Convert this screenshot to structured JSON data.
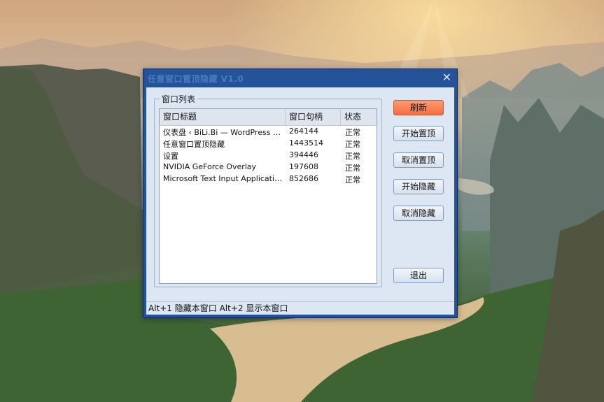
{
  "window": {
    "title": "任意窗口置顶隐藏 V1.0",
    "close_glyph": "✕"
  },
  "group": {
    "label": "窗口列表"
  },
  "list": {
    "columns": [
      "窗口标题",
      "窗口句柄",
      "状态"
    ],
    "rows": [
      [
        "仪表盘 ‹ BiLi.Bi — WordPress 和…",
        "264144",
        "正常"
      ],
      [
        "任意窗口置顶隐藏",
        "1443514",
        "正常"
      ],
      [
        "设置",
        "394446",
        "正常"
      ],
      [
        "NVIDIA GeForce Overlay",
        "197608",
        "正常"
      ],
      [
        "Microsoft Text Input Application",
        "852686",
        "正常"
      ]
    ]
  },
  "buttons": {
    "refresh": "刷新",
    "start_top": "开始置顶",
    "cancel_top": "取消置顶",
    "start_hide": "开始隐藏",
    "cancel_hide": "取消隐藏",
    "exit": "退出"
  },
  "status": {
    "text": "Alt+1 隐藏本窗口 Alt+2 显示本窗口"
  },
  "colors": {
    "accent_button": "#f46d40",
    "frame": "#24539a",
    "client": "#dde7f3"
  }
}
